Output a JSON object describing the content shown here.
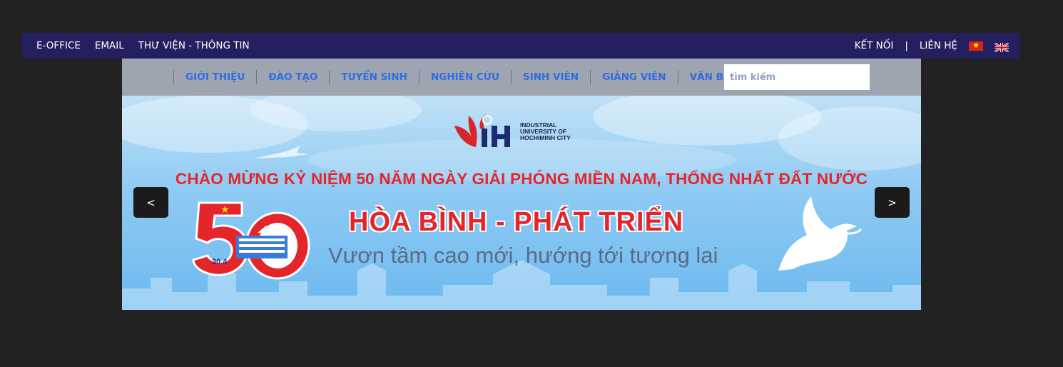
{
  "topbar": {
    "left_links": [
      "E-OFFICE",
      "EMAIL",
      "THƯ VIỆN - THÔNG TIN"
    ],
    "right_links": {
      "connect": "KẾT NỐI",
      "separator": "|",
      "contact": "LIÊN HỆ"
    },
    "flags": [
      "vietnam-flag-icon",
      "uk-flag-icon"
    ]
  },
  "nav": {
    "items": [
      "GIỚI THIỆU",
      "ĐÀO TẠO",
      "TUYỂN SINH",
      "NGHIÊN CỨU",
      "SINH VIÊN",
      "GIẢNG VIÊN",
      "VĂN BẰNG"
    ],
    "search_placeholder": "tìm kiếm"
  },
  "banner": {
    "logo_letters": "IH",
    "logo_text": [
      "INDUSTRIAL",
      "UNIVERSITY OF",
      "HOCHIMINH CITY"
    ],
    "headline": "CHÀO MỪNG KỶ NIỆM 50 NĂM NGÀY GIẢI PHÓNG MIỀN NAM, THỐNG NHẤT ĐẤT NƯỚC",
    "slogan": "HÒA BÌNH - PHÁT TRIỂN",
    "subslogan": "Vươn tầm cao mới, hướng tới tương lai",
    "emblem_number": "50",
    "emblem_date": "30.4",
    "prev_label": "<",
    "next_label": ">"
  },
  "colors": {
    "page_bg": "#222222",
    "topbar_bg": "#241f5e",
    "nav_bg": "#9fa4b1",
    "nav_text": "#2f6de0",
    "banner_red": "#e4262b"
  }
}
